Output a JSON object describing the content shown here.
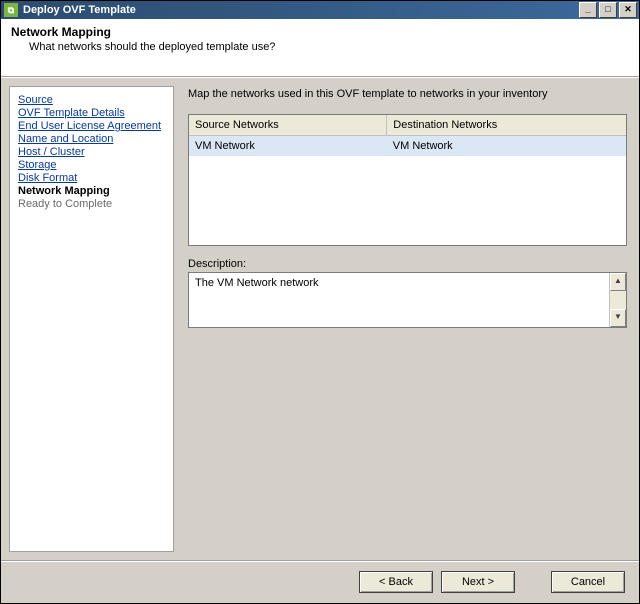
{
  "window": {
    "title": "Deploy OVF Template"
  },
  "header": {
    "step_title": "Network Mapping",
    "step_desc": "What networks should the deployed template use?"
  },
  "sidebar": {
    "steps": [
      "Source",
      "OVF Template Details",
      "End User License Agreement",
      "Name and Location",
      "Host / Cluster",
      "Storage",
      "Disk Format",
      "Network Mapping",
      "Ready to Complete"
    ]
  },
  "main": {
    "instruction": "Map the networks used in this OVF template to networks in your inventory",
    "columns": {
      "source": "Source Networks",
      "dest": "Destination Networks"
    },
    "rows": [
      {
        "source": "VM Network",
        "dest": "VM Network"
      }
    ],
    "desc_label": "Description:",
    "desc_text": "The VM Network network"
  },
  "footer": {
    "back": "< Back",
    "next": "Next >",
    "cancel": "Cancel"
  }
}
